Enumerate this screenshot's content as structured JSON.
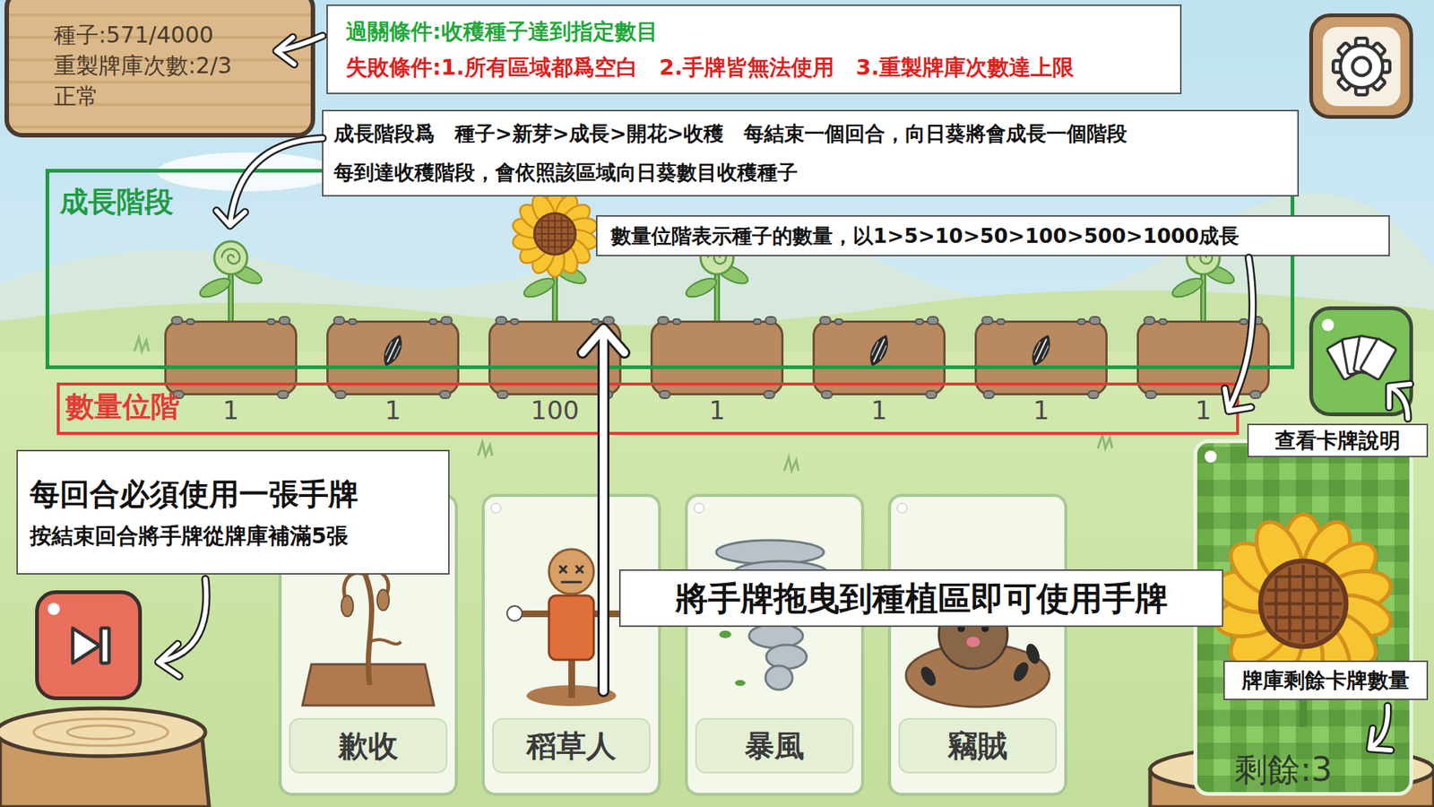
{
  "status_sign": {
    "seeds": "種子:571/4000",
    "resets": "重製牌庫次數:2/3",
    "condition": "正常"
  },
  "rules": {
    "win": "過關條件:收穫種子達到指定數目",
    "lose": "失敗條件:1.所有區域都爲空白　2.手牌皆無法使用　3.重製牌庫次數達上限"
  },
  "growth_note": {
    "line1": "成長階段爲　種子>新芽>成長>開花>收穫　每結束一個回合，向日葵將會成長一個階段",
    "line2": "每到達收穫階段，會依照該區域向日葵數目收穫種子"
  },
  "quantity_note": "數量位階表示種子的數量，以1>5>10>50>100>500>1000成長",
  "growth_label": "成長階段",
  "quantity_label": "數量位階",
  "plots": [
    {
      "kind": "sprout",
      "count": "1"
    },
    {
      "kind": "seed",
      "count": "1"
    },
    {
      "kind": "flower",
      "count": "100"
    },
    {
      "kind": "sprout",
      "count": "1"
    },
    {
      "kind": "seed",
      "count": "1"
    },
    {
      "kind": "seed",
      "count": "1"
    },
    {
      "kind": "sprout",
      "count": "1"
    }
  ],
  "hand_rule": {
    "title": "每回合必須使用一張手牌",
    "detail": "按結束回合將手牌從牌庫補滿5張"
  },
  "drag_hint": "將手牌拖曳到種植區即可使用手牌",
  "hand": [
    {
      "label": "歉收",
      "kind": "blight"
    },
    {
      "label": "稻草人",
      "kind": "scarecrow"
    },
    {
      "label": "暴風",
      "kind": "storm"
    },
    {
      "label": "竊賊",
      "kind": "thief"
    }
  ],
  "card_info_label": "查看卡牌說明",
  "deck": {
    "label": "牌庫剩餘卡牌數量",
    "remaining": "剩餘:3"
  }
}
